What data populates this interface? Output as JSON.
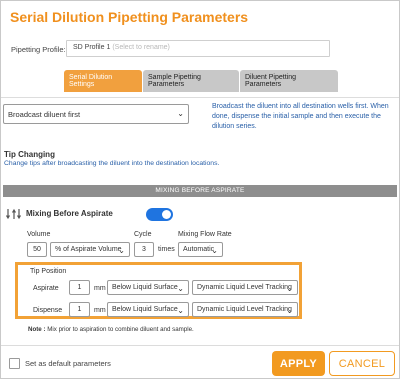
{
  "dialog": {
    "title": "Serial Dilution Pipetting Parameters"
  },
  "profile": {
    "label": "Pipetting Profile:",
    "value": "SD Profile 1",
    "hint": "(Select to rename)"
  },
  "tabs": [
    {
      "label": "Serial Dilution Settings",
      "active": true
    },
    {
      "label": "Sample Pipetting Parameters",
      "active": false
    },
    {
      "label": "Diluent Pipetting Parameters",
      "active": false
    }
  ],
  "broadcast": {
    "selected": "Broadcast diluent first",
    "description": "Broadcast the diluent into all destination wells first. When done, dispense the initial sample and then execute the dilution series."
  },
  "tip_changing": {
    "title": "Tip Changing",
    "description": "Change tips after broadcasting the diluent into the destination locations."
  },
  "mixing": {
    "section_title": "MIXING BEFORE ASPIRATE",
    "label": "Mixing Before Aspirate",
    "enabled": true,
    "volume_label": "Volume",
    "volume_value": "50",
    "volume_unit": "% of Aspirate Volume",
    "cycle_label": "Cycle",
    "cycle_value": "3",
    "cycle_unit": "times",
    "flow_rate_label": "Mixing Flow Rate",
    "flow_rate_value": "Automatic"
  },
  "tip_position": {
    "title": "Tip Position",
    "rows": [
      {
        "label": "Aspirate",
        "value": "1",
        "unit": "mm",
        "reference": "Below Liquid Surface",
        "tracking": "Dynamic Liquid Level Tracking"
      },
      {
        "label": "Dispense",
        "value": "1",
        "unit": "mm",
        "reference": "Below Liquid Surface",
        "tracking": "Dynamic Liquid Level Tracking"
      }
    ]
  },
  "note": {
    "prefix": "Note :",
    "text": "Mix prior to aspiration to combine diluent and sample."
  },
  "footer": {
    "default_label": "Set as default parameters",
    "apply_label": "APPLY",
    "cancel_label": "CANCEL"
  },
  "colors": {
    "accent": "#f29a20",
    "toggle_on": "#1f74e0",
    "info_text": "#2a60a8"
  }
}
